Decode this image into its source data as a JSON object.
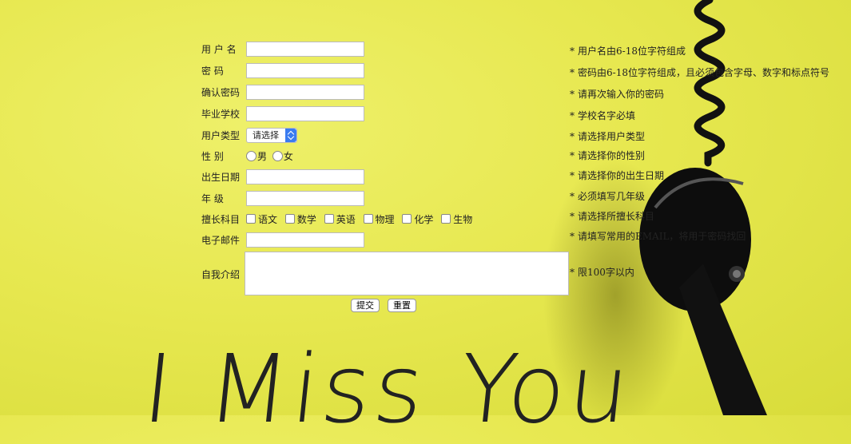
{
  "form": {
    "username": {
      "label": "用 户 名",
      "value": "",
      "hint": "用户名由6-18位字符组成"
    },
    "password": {
      "label": "密  码",
      "value": "",
      "hint": "密码由6-18位字符组成，且必须包含字母、数字和标点符号"
    },
    "confirm_password": {
      "label": "确认密码",
      "value": "",
      "hint": "请再次输入你的密码"
    },
    "school": {
      "label": "毕业学校",
      "value": "",
      "hint": "学校名字必填"
    },
    "user_type": {
      "label": "用户类型",
      "selected": "请选择",
      "hint": "请选择用户类型"
    },
    "gender": {
      "label": "性  别",
      "options": [
        "男",
        "女"
      ],
      "hint": "请选择你的性别"
    },
    "birth_date": {
      "label": "出生日期",
      "value": "",
      "hint": "请选择你的出生日期"
    },
    "grade": {
      "label": "年 级",
      "value": "",
      "hint": "必须填写几年级"
    },
    "subjects": {
      "label": "擅长科目",
      "options": [
        "语文",
        "数学",
        "英语",
        "物理",
        "化学",
        "生物"
      ],
      "hint": "请选择所擅长科目"
    },
    "email": {
      "label": "电子邮件",
      "value": "",
      "hint": "请填写常用的EMAIL，将用于密码找回"
    },
    "bio": {
      "label": "自我介绍",
      "value": "",
      "hint": "限100字以内"
    },
    "hint_marker": "*",
    "submit_label": "提交",
    "reset_label": "重置"
  },
  "background": {
    "text": "I Miss You",
    "colors": {
      "yellow": "#e7e850",
      "handset": "#111111"
    }
  }
}
